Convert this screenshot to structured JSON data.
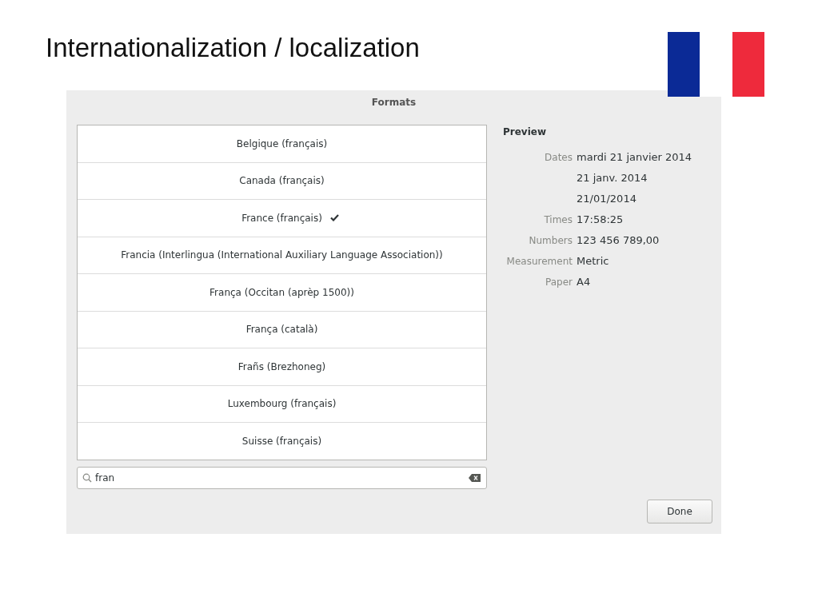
{
  "slide": {
    "title": "Internationalization / localization"
  },
  "dialog": {
    "title": "Formats",
    "formats": [
      {
        "label": "Belgique (français)",
        "selected": false
      },
      {
        "label": "Canada (français)",
        "selected": false
      },
      {
        "label": "France (français)",
        "selected": true
      },
      {
        "label": "Francia (Interlingua (International Auxiliary Language Association))",
        "selected": false
      },
      {
        "label": "França (Occitan (aprèp 1500))",
        "selected": false
      },
      {
        "label": "França (català)",
        "selected": false
      },
      {
        "label": "Frañs (Brezhoneg)",
        "selected": false
      },
      {
        "label": "Luxembourg (français)",
        "selected": false
      },
      {
        "label": "Suisse (français)",
        "selected": false
      }
    ],
    "search": {
      "value": "fran"
    },
    "preview": {
      "heading": "Preview",
      "rows": [
        {
          "label": "Dates",
          "values": [
            "mardi 21 janvier 2014",
            "21 janv. 2014",
            "21/01/2014"
          ]
        },
        {
          "label": "Times",
          "values": [
            "17:58:25"
          ]
        },
        {
          "label": "Numbers",
          "values": [
            "123 456 789,00"
          ]
        },
        {
          "label": "Measurement",
          "values": [
            "Metric"
          ]
        },
        {
          "label": "Paper",
          "values": [
            "A4"
          ]
        }
      ]
    },
    "buttons": [
      "Done"
    ]
  }
}
